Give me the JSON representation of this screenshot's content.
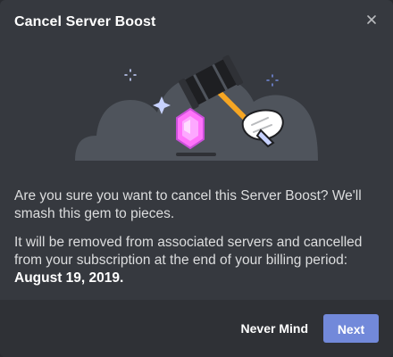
{
  "modal": {
    "title": "Cancel Server Boost",
    "close_icon": "close-icon"
  },
  "illustration": {
    "description_icon": "gem-hammer-illustration",
    "colors": {
      "cloud": "#4f545c",
      "gem": "#ff73fa",
      "hammer_head": "#1e1f22",
      "handle": "#f6a623",
      "sparkle": "#c7d2ff",
      "sparkle_blue": "#7289da"
    }
  },
  "body": {
    "paragraph1": "Are you sure you want to cancel this Server Boost? We'll smash this gem to pieces.",
    "paragraph2_prefix": "It will be removed from associated servers and cancelled from your subscription at the end of your billing period:",
    "date": "August 19, 2019."
  },
  "footer": {
    "secondary_label": "Never Mind",
    "primary_label": "Next"
  },
  "colors": {
    "background": "#36393f",
    "footer": "#2f3136",
    "primary": "#7289da",
    "text": "#dcddde"
  }
}
